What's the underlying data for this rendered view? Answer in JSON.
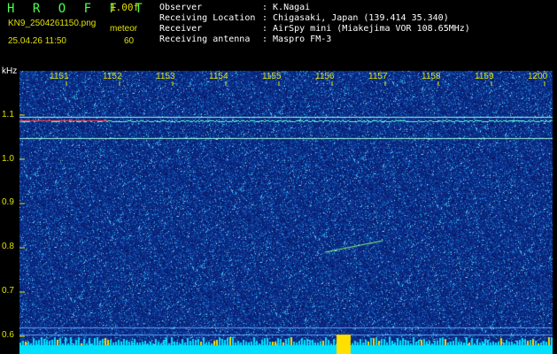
{
  "header": {
    "app_name": "H R O F F T",
    "version": "1.00f",
    "filename": "KN9_2504261150.png",
    "meteor_label": "meteor",
    "meteor_count": "60",
    "datetime": "25.04.26 11:50"
  },
  "info": [
    {
      "label": "Observer",
      "value": ": K.Nagai"
    },
    {
      "label": "Receiving Location",
      "value": ": Chigasaki, Japan (139.414 35.340)"
    },
    {
      "label": "Receiver",
      "value": ": AirSpy mini (Miakejima VOR 108.65MHz)"
    },
    {
      "label": "Receiving antenna",
      "value": ": Maspro FM-3"
    }
  ],
  "axis": {
    "y_unit": "kHz",
    "y_ticks": [
      "1.1",
      "1.0",
      "0.9",
      "0.8",
      "0.7",
      "0.6"
    ],
    "x_ticks": [
      "1151",
      "1152",
      "1153",
      "1154",
      "1155",
      "1156",
      "1157",
      "1158",
      "1159",
      "1200"
    ]
  },
  "colors": {
    "background": "#000000",
    "spectrogram_bg": "#0b2d8a",
    "label_yellow": "#e0e000",
    "brand_green": "#4dff4d",
    "carrier_line": "#ff4040",
    "noise_floor": "#00e0ff"
  }
}
